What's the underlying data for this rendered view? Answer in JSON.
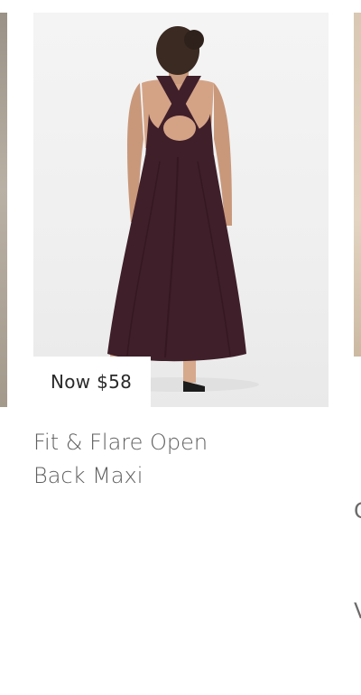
{
  "product": {
    "price_label": "Now $58",
    "title_line1": "Fit & Flare Open",
    "title_line2": "Back Maxi"
  },
  "next_product": {
    "title_line1": "C",
    "title_line2": "V"
  },
  "colors": {
    "dress": "#3f1f2a",
    "background": "#efefef"
  }
}
